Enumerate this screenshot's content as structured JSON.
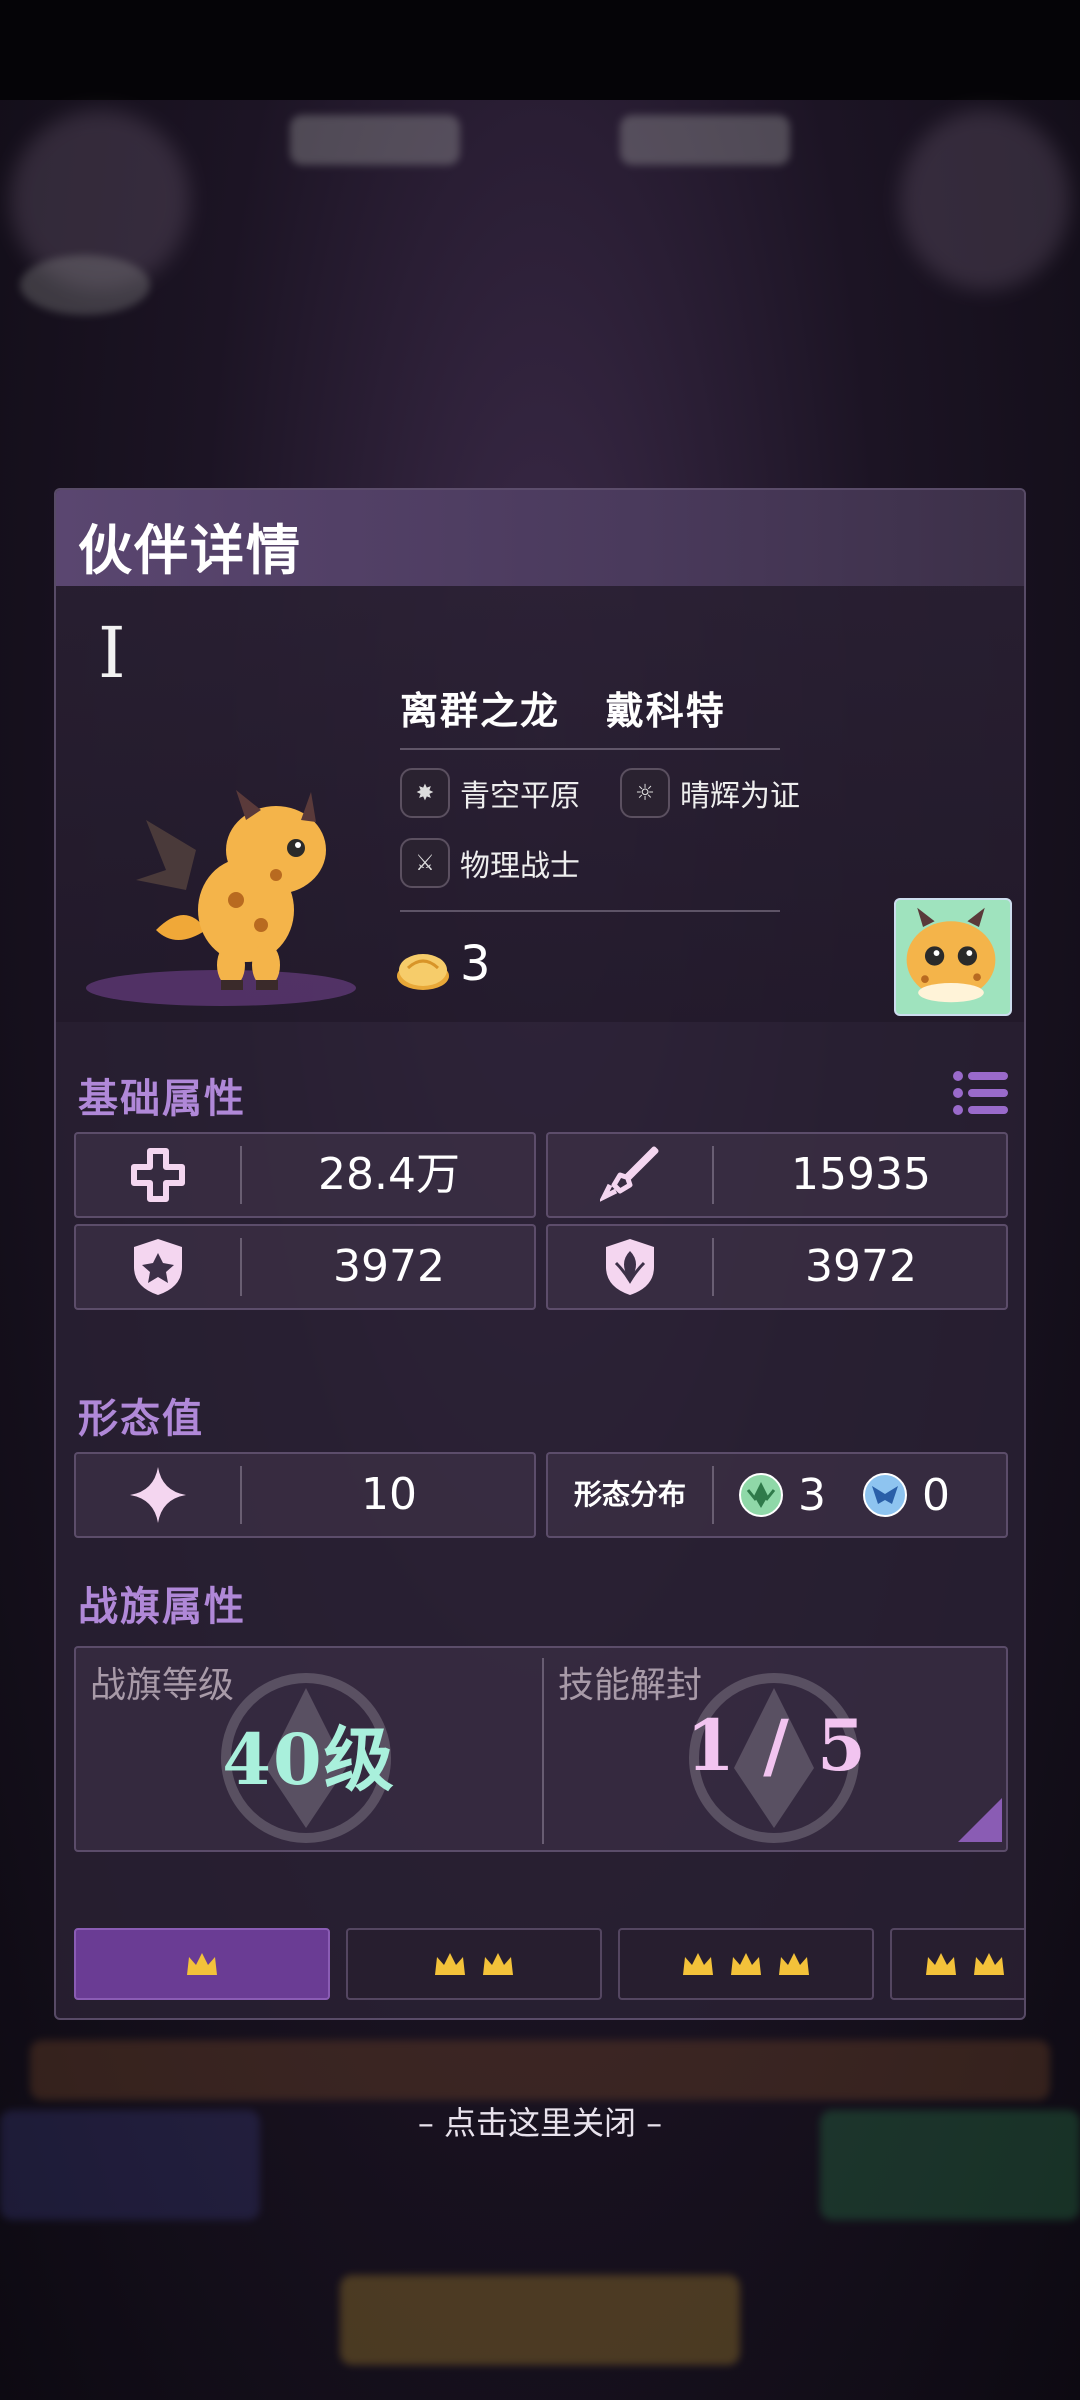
{
  "panel": {
    "title": "伙伴详情",
    "roman": "I",
    "character": {
      "name": "离群之龙   戴科特",
      "tags": [
        {
          "icon": "emblem-icon",
          "label": "青空平原"
        },
        {
          "icon": "sun-icon",
          "label": "晴辉为证"
        },
        {
          "icon": "sword-icon",
          "label": "物理战士"
        }
      ],
      "bun_count": "3"
    },
    "basic": {
      "title": "基础属性",
      "stats": [
        {
          "icon": "health-cross-icon",
          "value": "28.4万"
        },
        {
          "icon": "sword-attack-icon",
          "value": "15935"
        },
        {
          "icon": "shield-defense-icon",
          "value": "3972"
        },
        {
          "icon": "magic-shield-icon",
          "value": "3972"
        }
      ]
    },
    "form": {
      "title": "形态值",
      "value": "10",
      "dist_label": "形态分布",
      "dist": [
        {
          "icon": "green-form-icon",
          "value": "3"
        },
        {
          "icon": "blue-form-icon",
          "value": "0"
        }
      ]
    },
    "flag": {
      "title": "战旗属性",
      "level_label": "战旗等级",
      "level_value": "40级",
      "skill_label": "技能解封",
      "skill_value": "1 / 5"
    },
    "tabs": [
      1,
      2,
      3,
      2
    ]
  },
  "close_hint": "– 点击这里关闭 –",
  "colors": {
    "accent": "#b088d8",
    "level_text": "#a9f0dc",
    "skill_text": "#f2c4f0",
    "tab_active": "#6a3c94"
  }
}
